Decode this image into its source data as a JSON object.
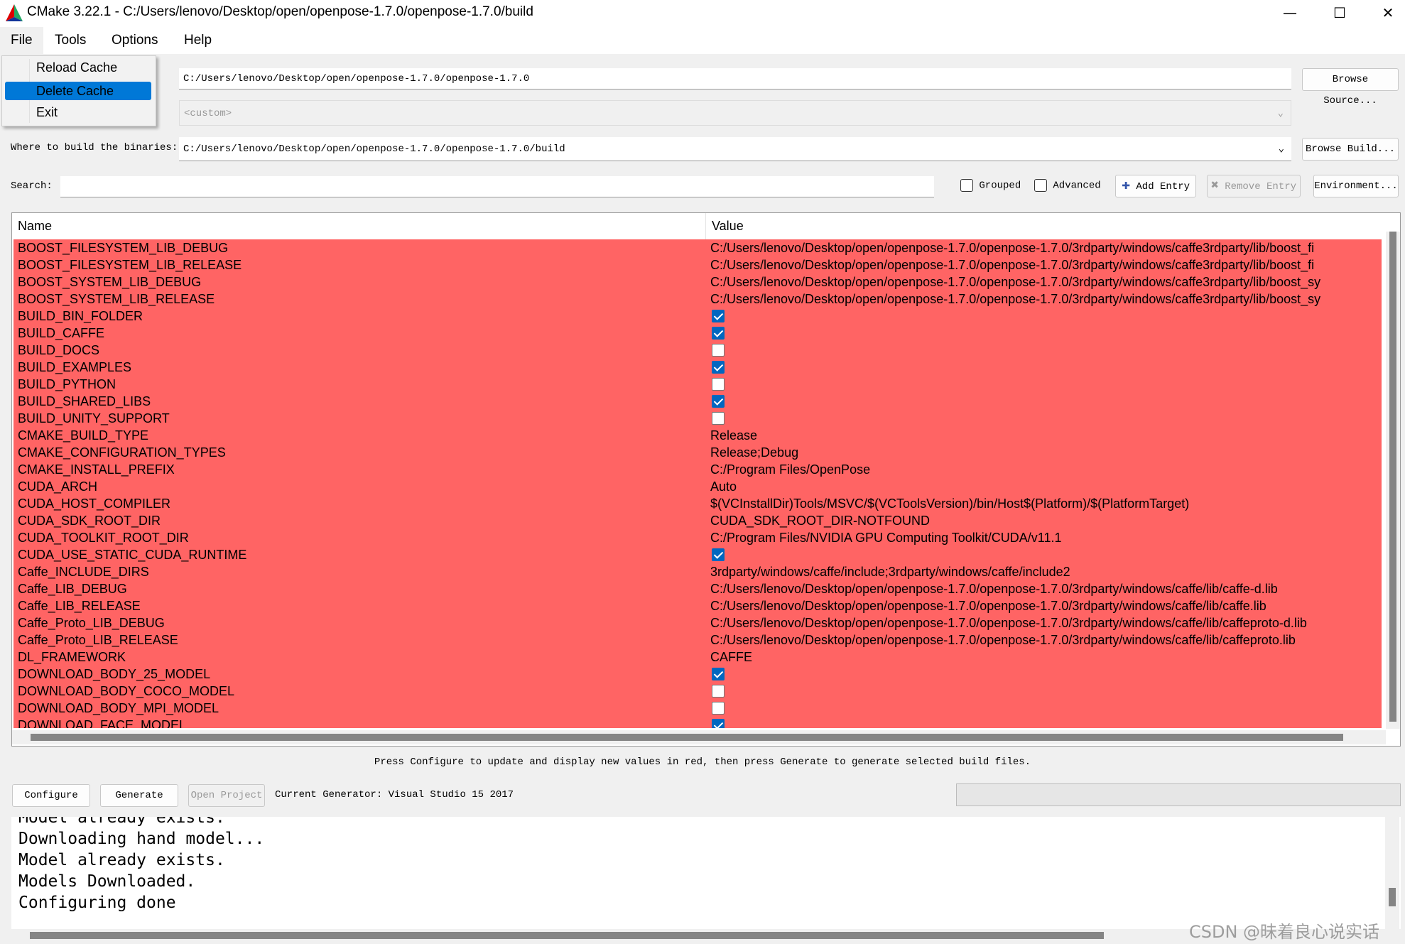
{
  "window": {
    "title": "CMake 3.22.1 - C:/Users/lenovo/Desktop/open/openpose-1.7.0/openpose-1.7.0/build",
    "minimize": "—",
    "maximize": "☐",
    "close": "✕"
  },
  "menu": [
    "File",
    "Tools",
    "Options",
    "Help"
  ],
  "file_menu": [
    "Reload Cache",
    "Delete Cache",
    "Exit"
  ],
  "source": {
    "value": "C:/Users/lenovo/Desktop/open/openpose-1.7.0/openpose-1.7.0",
    "browse": "Browse Source..."
  },
  "preset": {
    "placeholder": "<custom>"
  },
  "build": {
    "label": "Where to build the binaries:",
    "value": "C:/Users/lenovo/Desktop/open/openpose-1.7.0/openpose-1.7.0/build",
    "browse": "Browse Build..."
  },
  "search": {
    "label": "Search:",
    "value": ""
  },
  "options": {
    "grouped": "Grouped",
    "advanced": "Advanced",
    "add_entry": "Add Entry",
    "remove_entry": "Remove Entry",
    "environment": "Environment..."
  },
  "table": {
    "headers": [
      "Name",
      "Value"
    ],
    "row_color": "#ff6464",
    "rows": [
      {
        "name": "BOOST_FILESYSTEM_LIB_DEBUG",
        "value": "C:/Users/lenovo/Desktop/open/openpose-1.7.0/openpose-1.7.0/3rdparty/windows/caffe3rdparty/lib/boost_fi"
      },
      {
        "name": "BOOST_FILESYSTEM_LIB_RELEASE",
        "value": "C:/Users/lenovo/Desktop/open/openpose-1.7.0/openpose-1.7.0/3rdparty/windows/caffe3rdparty/lib/boost_fi"
      },
      {
        "name": "BOOST_SYSTEM_LIB_DEBUG",
        "value": "C:/Users/lenovo/Desktop/open/openpose-1.7.0/openpose-1.7.0/3rdparty/windows/caffe3rdparty/lib/boost_sy"
      },
      {
        "name": "BOOST_SYSTEM_LIB_RELEASE",
        "value": "C:/Users/lenovo/Desktop/open/openpose-1.7.0/openpose-1.7.0/3rdparty/windows/caffe3rdparty/lib/boost_sy"
      },
      {
        "name": "BUILD_BIN_FOLDER",
        "checked": true
      },
      {
        "name": "BUILD_CAFFE",
        "checked": true
      },
      {
        "name": "BUILD_DOCS",
        "checked": false
      },
      {
        "name": "BUILD_EXAMPLES",
        "checked": true
      },
      {
        "name": "BUILD_PYTHON",
        "checked": false
      },
      {
        "name": "BUILD_SHARED_LIBS",
        "checked": true
      },
      {
        "name": "BUILD_UNITY_SUPPORT",
        "checked": false
      },
      {
        "name": "CMAKE_BUILD_TYPE",
        "value": "Release"
      },
      {
        "name": "CMAKE_CONFIGURATION_TYPES",
        "value": "Release;Debug"
      },
      {
        "name": "CMAKE_INSTALL_PREFIX",
        "value": "C:/Program Files/OpenPose"
      },
      {
        "name": "CUDA_ARCH",
        "value": "Auto"
      },
      {
        "name": "CUDA_HOST_COMPILER",
        "value": "$(VCInstallDir)Tools/MSVC/$(VCToolsVersion)/bin/Host$(Platform)/$(PlatformTarget)"
      },
      {
        "name": "CUDA_SDK_ROOT_DIR",
        "value": "CUDA_SDK_ROOT_DIR-NOTFOUND"
      },
      {
        "name": "CUDA_TOOLKIT_ROOT_DIR",
        "value": "C:/Program Files/NVIDIA GPU Computing Toolkit/CUDA/v11.1"
      },
      {
        "name": "CUDA_USE_STATIC_CUDA_RUNTIME",
        "checked": true
      },
      {
        "name": "Caffe_INCLUDE_DIRS",
        "value": "3rdparty/windows/caffe/include;3rdparty/windows/caffe/include2"
      },
      {
        "name": "Caffe_LIB_DEBUG",
        "value": "C:/Users/lenovo/Desktop/open/openpose-1.7.0/openpose-1.7.0/3rdparty/windows/caffe/lib/caffe-d.lib"
      },
      {
        "name": "Caffe_LIB_RELEASE",
        "value": "C:/Users/lenovo/Desktop/open/openpose-1.7.0/openpose-1.7.0/3rdparty/windows/caffe/lib/caffe.lib"
      },
      {
        "name": "Caffe_Proto_LIB_DEBUG",
        "value": "C:/Users/lenovo/Desktop/open/openpose-1.7.0/openpose-1.7.0/3rdparty/windows/caffe/lib/caffeproto-d.lib"
      },
      {
        "name": "Caffe_Proto_LIB_RELEASE",
        "value": "C:/Users/lenovo/Desktop/open/openpose-1.7.0/openpose-1.7.0/3rdparty/windows/caffe/lib/caffeproto.lib"
      },
      {
        "name": "DL_FRAMEWORK",
        "value": "CAFFE"
      },
      {
        "name": "DOWNLOAD_BODY_25_MODEL",
        "checked": true
      },
      {
        "name": "DOWNLOAD_BODY_COCO_MODEL",
        "checked": false
      },
      {
        "name": "DOWNLOAD_BODY_MPI_MODEL",
        "checked": false
      },
      {
        "name": "DOWNLOAD_FACE_MODEL",
        "checked": true
      }
    ]
  },
  "status": "Press Configure to update and display new values in red, then press Generate to generate selected build files.",
  "actions": {
    "configure": "Configure",
    "generate": "Generate",
    "open_project": "Open Project",
    "generator": "Current Generator: Visual Studio 15 2017"
  },
  "output": [
    "Model already exists.",
    "Downloading hand model...",
    "Model already exists.",
    "Models Downloaded.",
    "Configuring done"
  ],
  "watermark": "CSDN @昧着良心说实话"
}
